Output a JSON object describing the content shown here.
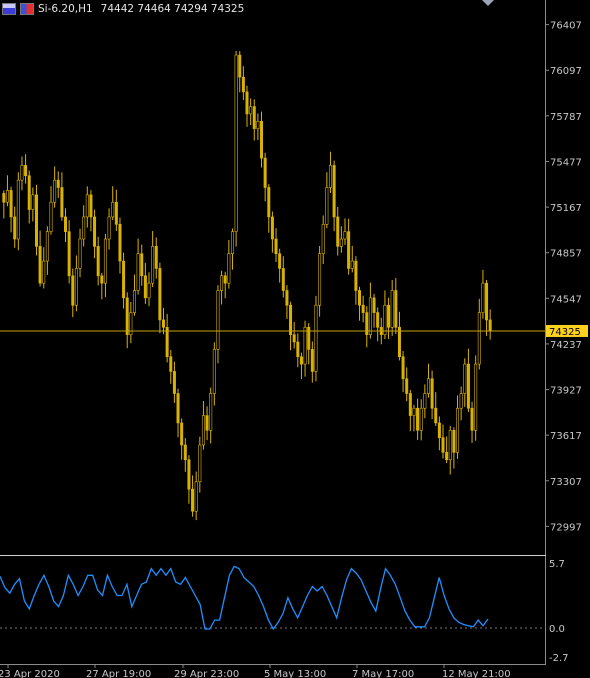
{
  "header": {
    "symbol_timeframe": "Si-6.20,H1",
    "ohlc": "74442 74464 74294 74325"
  },
  "main_chart": {
    "price_ticks": [
      "76407",
      "76097",
      "75787",
      "75477",
      "75167",
      "74857",
      "74547",
      "74237",
      "73927",
      "73617",
      "73307",
      "72997"
    ],
    "current_price_label": "74325",
    "current_price": 74325,
    "colors": {
      "candle": "#d9b300",
      "price_line": "#c8a400",
      "price_badge": "#ffd21f",
      "background": "#000000",
      "axis_text": "#c8c8c8"
    }
  },
  "indicator": {
    "ticks": [
      "5.7",
      "0.0",
      "-2.7"
    ],
    "line_color": "#1e90ff"
  },
  "time_axis": {
    "labels": [
      "23 Apr 2020",
      "27 Apr 19:00",
      "29 Apr 23:00",
      "5 May 13:00",
      "7 May 17:00",
      "12 May 21:00"
    ]
  },
  "chart_data": [
    {
      "type": "candlestick",
      "y_range": [
        72850,
        76520
      ],
      "close_series": [
        75200,
        75280,
        75100,
        74950,
        75350,
        75450,
        75380,
        75150,
        75250,
        74900,
        74650,
        74800,
        75000,
        75200,
        75350,
        75300,
        75100,
        75000,
        74700,
        74500,
        74750,
        74950,
        75100,
        75250,
        75100,
        74900,
        74700,
        74650,
        74950,
        75100,
        75200,
        75050,
        74800,
        74550,
        74300,
        74450,
        74600,
        74850,
        74700,
        74550,
        74650,
        74900,
        74750,
        74400,
        74350,
        74150,
        74050,
        73900,
        73700,
        73550,
        73450,
        73250,
        73100,
        73300,
        73550,
        73750,
        73650,
        73900,
        74200,
        74600,
        74700,
        74650,
        74850,
        75000,
        76200,
        76050,
        75950,
        75800,
        75850,
        75700,
        75750,
        75500,
        75300,
        75100,
        74950,
        74850,
        74750,
        74600,
        74500,
        74300,
        74250,
        74150,
        74100,
        74350,
        74200,
        74050,
        74500,
        74850,
        75050,
        75300,
        75450,
        75100,
        74900,
        74950,
        75000,
        74750,
        74800,
        74600,
        74500,
        74450,
        74300,
        74550,
        74450,
        74350,
        74300,
        74500,
        74350,
        74600,
        74350,
        74150,
        74000,
        73900,
        73750,
        73800,
        73650,
        73800,
        73900,
        74000,
        73800,
        73700,
        73600,
        73500,
        73450,
        73650,
        73500,
        73800,
        73900,
        74100,
        73800,
        73650,
        74100,
        74450,
        74650,
        74400,
        74325
      ],
      "current_price": 74325
    },
    {
      "type": "line",
      "y_range": [
        -2.7,
        5.7
      ],
      "values": [
        4.5,
        3.5,
        3.0,
        3.8,
        4.3,
        2.3,
        1.6,
        2.8,
        3.8,
        4.6,
        3.6,
        2.3,
        1.8,
        2.8,
        4.6,
        3.8,
        2.8,
        3.6,
        4.6,
        4.6,
        3.3,
        2.8,
        4.6,
        3.6,
        2.8,
        2.8,
        3.8,
        1.8,
        2.8,
        3.8,
        4.0,
        5.2,
        4.6,
        5.2,
        4.6,
        5.2,
        4.0,
        3.8,
        4.4,
        3.6,
        2.8,
        2.0,
        -0.2,
        -0.2,
        0.6,
        0.6,
        2.6,
        4.6,
        5.4,
        5.2,
        4.4,
        4.0,
        3.6,
        2.8,
        1.8,
        0.6,
        -0.2,
        0.4,
        1.2,
        2.6,
        1.6,
        0.8,
        1.8,
        2.8,
        3.6,
        3.2,
        3.6,
        2.8,
        1.8,
        0.8,
        2.6,
        4.2,
        5.2,
        4.8,
        4.2,
        3.2,
        2.2,
        1.4,
        3.4,
        5.2,
        4.6,
        3.8,
        2.6,
        1.4,
        0.6,
        0.0,
        0.0,
        0.0,
        0.8,
        2.6,
        4.4,
        2.8,
        1.6,
        0.8,
        0.4,
        0.2,
        0.1,
        0.0,
        0.6,
        0.1,
        0.7
      ]
    }
  ]
}
